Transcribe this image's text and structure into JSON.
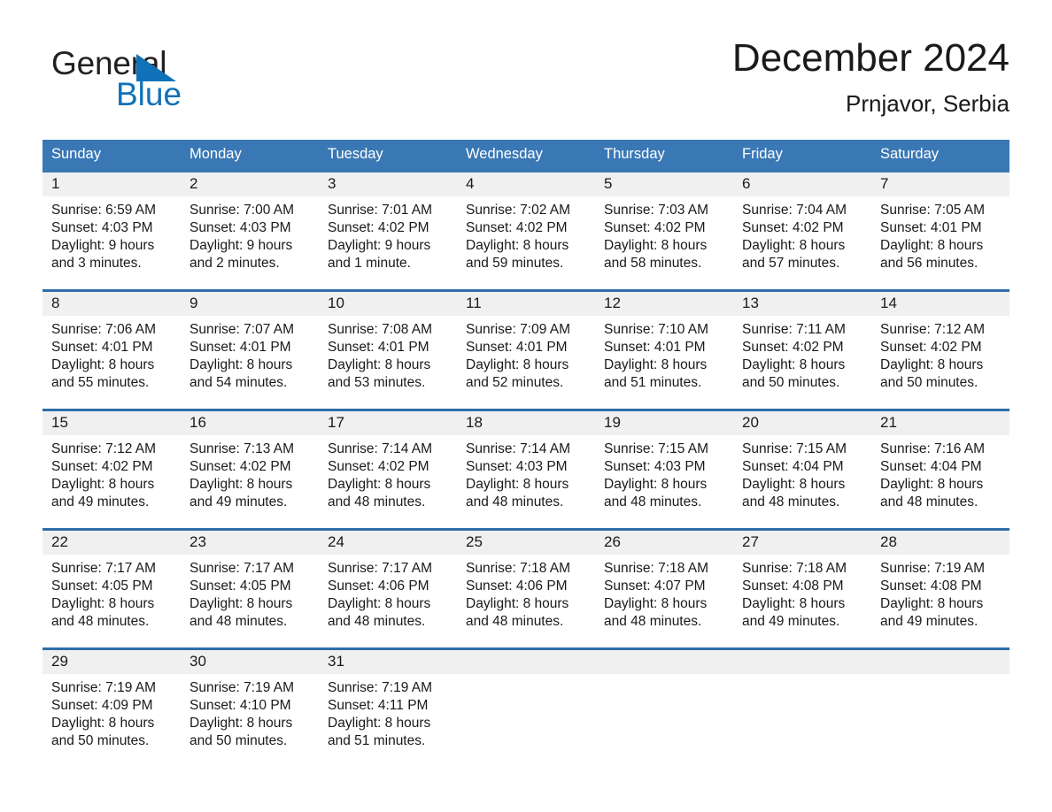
{
  "brand": {
    "name_part1": "General",
    "name_part2": "Blue",
    "triangle_color": "#1072b8",
    "text_color": "#231f20"
  },
  "header": {
    "title": "December 2024",
    "location": "Prnjavor, Serbia"
  },
  "theme": {
    "header_blue": "#3a78b5",
    "separator_blue": "#2e6da8",
    "daynum_band": "#f0f0f0",
    "text": "#1a1a1a"
  },
  "day_headers": [
    "Sunday",
    "Monday",
    "Tuesday",
    "Wednesday",
    "Thursday",
    "Friday",
    "Saturday"
  ],
  "weeks": [
    [
      {
        "day": "1",
        "sunrise": "Sunrise: 6:59 AM",
        "sunset": "Sunset: 4:03 PM",
        "daylight1": "Daylight: 9 hours",
        "daylight2": "and 3 minutes."
      },
      {
        "day": "2",
        "sunrise": "Sunrise: 7:00 AM",
        "sunset": "Sunset: 4:03 PM",
        "daylight1": "Daylight: 9 hours",
        "daylight2": "and 2 minutes."
      },
      {
        "day": "3",
        "sunrise": "Sunrise: 7:01 AM",
        "sunset": "Sunset: 4:02 PM",
        "daylight1": "Daylight: 9 hours",
        "daylight2": "and 1 minute."
      },
      {
        "day": "4",
        "sunrise": "Sunrise: 7:02 AM",
        "sunset": "Sunset: 4:02 PM",
        "daylight1": "Daylight: 8 hours",
        "daylight2": "and 59 minutes."
      },
      {
        "day": "5",
        "sunrise": "Sunrise: 7:03 AM",
        "sunset": "Sunset: 4:02 PM",
        "daylight1": "Daylight: 8 hours",
        "daylight2": "and 58 minutes."
      },
      {
        "day": "6",
        "sunrise": "Sunrise: 7:04 AM",
        "sunset": "Sunset: 4:02 PM",
        "daylight1": "Daylight: 8 hours",
        "daylight2": "and 57 minutes."
      },
      {
        "day": "7",
        "sunrise": "Sunrise: 7:05 AM",
        "sunset": "Sunset: 4:01 PM",
        "daylight1": "Daylight: 8 hours",
        "daylight2": "and 56 minutes."
      }
    ],
    [
      {
        "day": "8",
        "sunrise": "Sunrise: 7:06 AM",
        "sunset": "Sunset: 4:01 PM",
        "daylight1": "Daylight: 8 hours",
        "daylight2": "and 55 minutes."
      },
      {
        "day": "9",
        "sunrise": "Sunrise: 7:07 AM",
        "sunset": "Sunset: 4:01 PM",
        "daylight1": "Daylight: 8 hours",
        "daylight2": "and 54 minutes."
      },
      {
        "day": "10",
        "sunrise": "Sunrise: 7:08 AM",
        "sunset": "Sunset: 4:01 PM",
        "daylight1": "Daylight: 8 hours",
        "daylight2": "and 53 minutes."
      },
      {
        "day": "11",
        "sunrise": "Sunrise: 7:09 AM",
        "sunset": "Sunset: 4:01 PM",
        "daylight1": "Daylight: 8 hours",
        "daylight2": "and 52 minutes."
      },
      {
        "day": "12",
        "sunrise": "Sunrise: 7:10 AM",
        "sunset": "Sunset: 4:01 PM",
        "daylight1": "Daylight: 8 hours",
        "daylight2": "and 51 minutes."
      },
      {
        "day": "13",
        "sunrise": "Sunrise: 7:11 AM",
        "sunset": "Sunset: 4:02 PM",
        "daylight1": "Daylight: 8 hours",
        "daylight2": "and 50 minutes."
      },
      {
        "day": "14",
        "sunrise": "Sunrise: 7:12 AM",
        "sunset": "Sunset: 4:02 PM",
        "daylight1": "Daylight: 8 hours",
        "daylight2": "and 50 minutes."
      }
    ],
    [
      {
        "day": "15",
        "sunrise": "Sunrise: 7:12 AM",
        "sunset": "Sunset: 4:02 PM",
        "daylight1": "Daylight: 8 hours",
        "daylight2": "and 49 minutes."
      },
      {
        "day": "16",
        "sunrise": "Sunrise: 7:13 AM",
        "sunset": "Sunset: 4:02 PM",
        "daylight1": "Daylight: 8 hours",
        "daylight2": "and 49 minutes."
      },
      {
        "day": "17",
        "sunrise": "Sunrise: 7:14 AM",
        "sunset": "Sunset: 4:02 PM",
        "daylight1": "Daylight: 8 hours",
        "daylight2": "and 48 minutes."
      },
      {
        "day": "18",
        "sunrise": "Sunrise: 7:14 AM",
        "sunset": "Sunset: 4:03 PM",
        "daylight1": "Daylight: 8 hours",
        "daylight2": "and 48 minutes."
      },
      {
        "day": "19",
        "sunrise": "Sunrise: 7:15 AM",
        "sunset": "Sunset: 4:03 PM",
        "daylight1": "Daylight: 8 hours",
        "daylight2": "and 48 minutes."
      },
      {
        "day": "20",
        "sunrise": "Sunrise: 7:15 AM",
        "sunset": "Sunset: 4:04 PM",
        "daylight1": "Daylight: 8 hours",
        "daylight2": "and 48 minutes."
      },
      {
        "day": "21",
        "sunrise": "Sunrise: 7:16 AM",
        "sunset": "Sunset: 4:04 PM",
        "daylight1": "Daylight: 8 hours",
        "daylight2": "and 48 minutes."
      }
    ],
    [
      {
        "day": "22",
        "sunrise": "Sunrise: 7:17 AM",
        "sunset": "Sunset: 4:05 PM",
        "daylight1": "Daylight: 8 hours",
        "daylight2": "and 48 minutes."
      },
      {
        "day": "23",
        "sunrise": "Sunrise: 7:17 AM",
        "sunset": "Sunset: 4:05 PM",
        "daylight1": "Daylight: 8 hours",
        "daylight2": "and 48 minutes."
      },
      {
        "day": "24",
        "sunrise": "Sunrise: 7:17 AM",
        "sunset": "Sunset: 4:06 PM",
        "daylight1": "Daylight: 8 hours",
        "daylight2": "and 48 minutes."
      },
      {
        "day": "25",
        "sunrise": "Sunrise: 7:18 AM",
        "sunset": "Sunset: 4:06 PM",
        "daylight1": "Daylight: 8 hours",
        "daylight2": "and 48 minutes."
      },
      {
        "day": "26",
        "sunrise": "Sunrise: 7:18 AM",
        "sunset": "Sunset: 4:07 PM",
        "daylight1": "Daylight: 8 hours",
        "daylight2": "and 48 minutes."
      },
      {
        "day": "27",
        "sunrise": "Sunrise: 7:18 AM",
        "sunset": "Sunset: 4:08 PM",
        "daylight1": "Daylight: 8 hours",
        "daylight2": "and 49 minutes."
      },
      {
        "day": "28",
        "sunrise": "Sunrise: 7:19 AM",
        "sunset": "Sunset: 4:08 PM",
        "daylight1": "Daylight: 8 hours",
        "daylight2": "and 49 minutes."
      }
    ],
    [
      {
        "day": "29",
        "sunrise": "Sunrise: 7:19 AM",
        "sunset": "Sunset: 4:09 PM",
        "daylight1": "Daylight: 8 hours",
        "daylight2": "and 50 minutes."
      },
      {
        "day": "30",
        "sunrise": "Sunrise: 7:19 AM",
        "sunset": "Sunset: 4:10 PM",
        "daylight1": "Daylight: 8 hours",
        "daylight2": "and 50 minutes."
      },
      {
        "day": "31",
        "sunrise": "Sunrise: 7:19 AM",
        "sunset": "Sunset: 4:11 PM",
        "daylight1": "Daylight: 8 hours",
        "daylight2": "and 51 minutes."
      },
      {
        "day": "",
        "sunrise": "",
        "sunset": "",
        "daylight1": "",
        "daylight2": ""
      },
      {
        "day": "",
        "sunrise": "",
        "sunset": "",
        "daylight1": "",
        "daylight2": ""
      },
      {
        "day": "",
        "sunrise": "",
        "sunset": "",
        "daylight1": "",
        "daylight2": ""
      },
      {
        "day": "",
        "sunrise": "",
        "sunset": "",
        "daylight1": "",
        "daylight2": ""
      }
    ]
  ]
}
